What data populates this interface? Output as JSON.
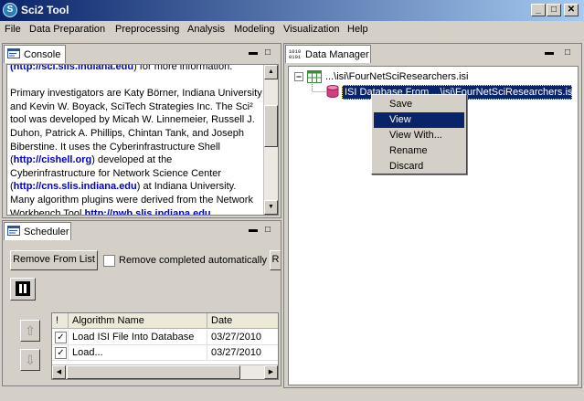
{
  "window": {
    "title": "Sci2 Tool",
    "app_icon": "S"
  },
  "controls": {
    "minimize": "_",
    "maximize": "□",
    "close": "✕",
    "panel_minimize": "▬",
    "panel_maximize": "□"
  },
  "menubar": [
    "File",
    "Data Preparation",
    "Preprocessing",
    "Analysis",
    "Modeling",
    "Visualization",
    "Help"
  ],
  "console": {
    "tab_label": "Console",
    "lines": [
      [
        {
          "t": "(http://sci.slis.indiana.edu",
          "link": true
        },
        {
          "t": ") for more information."
        }
      ],
      [
        {
          "t": ""
        }
      ],
      [
        {
          "t": "Primary investigators are Katy Börner, Indiana University"
        }
      ],
      [
        {
          "t": "and Kevin W. Boyack, SciTech Strategies Inc. The Sci²"
        }
      ],
      [
        {
          "t": "tool was developed by Micah W. Linnemeier, Russell J."
        }
      ],
      [
        {
          "t": "Duhon, Patrick A. Phillips, Chintan Tank, and Joseph"
        }
      ],
      [
        {
          "t": "Biberstine. It uses the Cyberinfrastructure Shell"
        }
      ],
      [
        {
          "t": "("
        },
        {
          "t": "http://cishell.org",
          "link": true
        },
        {
          "t": ") developed at the"
        }
      ],
      [
        {
          "t": "Cyberinfrastructure for Network Science Center"
        }
      ],
      [
        {
          "t": "("
        },
        {
          "t": "http://cns.slis.indiana.edu",
          "link": true
        },
        {
          "t": ") at Indiana University."
        }
      ],
      [
        {
          "t": "Many algorithm plugins were derived from the Network"
        }
      ],
      [
        {
          "t": "Workbench Tool "
        },
        {
          "t": "http://nwb.slis.indiana.edu.",
          "link": true
        }
      ]
    ]
  },
  "scheduler": {
    "tab_label": "Scheduler",
    "remove_button": "Remove From List",
    "remove_completed_label": "Remove completed automatically",
    "extra_button": "R",
    "pause_icon": "pause-icon",
    "move_up_icon": "⇧",
    "move_down_icon": "⇩",
    "columns": [
      "!",
      "Algorithm Name",
      "Date"
    ],
    "rows": [
      {
        "checked": true,
        "name": "Load ISI File Into Database",
        "date": "03/27/2010"
      },
      {
        "checked": true,
        "name": "Load...",
        "date": "03/27/2010"
      }
    ]
  },
  "data_manager": {
    "tab_label": "Data Manager",
    "tab_icon_text": "1010\n0101",
    "tree": [
      {
        "label": "...\\isi\\FourNetSciResearchers.isi",
        "icon": "table-icon",
        "expanded": true
      },
      {
        "label": "ISI Database From ...\\isi\\FourNetSciResearchers.isi",
        "icon": "database-icon",
        "selected": true
      }
    ],
    "context_menu": [
      "Save",
      "View",
      "View With...",
      "Rename",
      "Discard"
    ],
    "selected_menu_item": "View"
  },
  "colors": {
    "title_start": "#0a246a",
    "title_end": "#a6caf0",
    "selection": "#0a246a",
    "link": "#0000cc"
  }
}
